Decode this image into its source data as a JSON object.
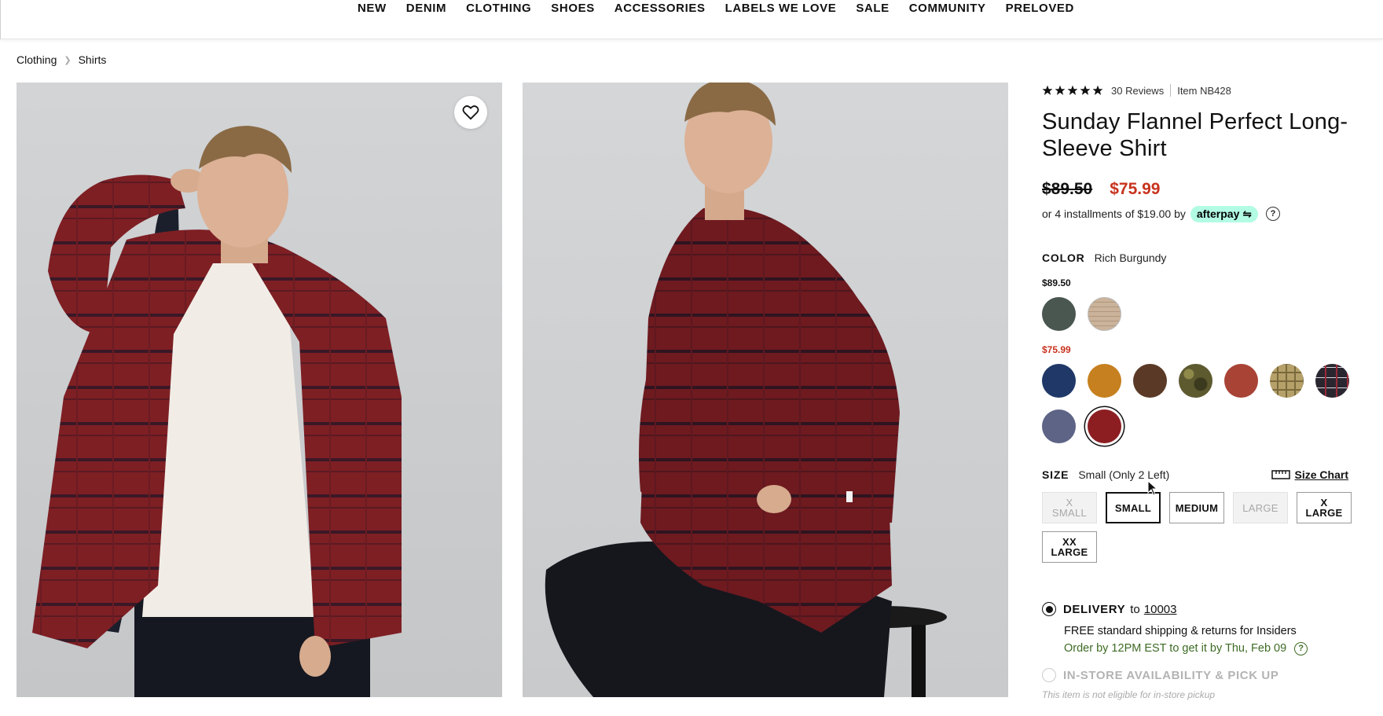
{
  "nav": {
    "items": [
      "NEW",
      "DENIM",
      "CLOTHING",
      "SHOES",
      "ACCESSORIES",
      "LABELS WE LOVE",
      "SALE",
      "COMMUNITY",
      "PRELOVED"
    ]
  },
  "breadcrumb": {
    "items": [
      "Clothing",
      "Shirts"
    ]
  },
  "product": {
    "reviews": "30 Reviews",
    "item": "Item NB428",
    "title": "Sunday Flannel Perfect Long-Sleeve Shirt",
    "price_original": "$89.50",
    "price_sale": "$75.99",
    "installments": "or 4 installments of $19.00 by",
    "afterpay": "afterpay",
    "color_label": "COLOR",
    "color_value": "Rich Burgundy",
    "tier_full_price": "$89.50",
    "tier_sale_price": "$75.99",
    "size_label": "SIZE",
    "size_value": "Small (Only 2 Left)",
    "size_chart": "Size Chart",
    "delivery_label": "DELIVERY",
    "delivery_to": "to",
    "delivery_zip": "10003",
    "shipping_bold": "FREE standard shipping & returns",
    "shipping_rest": " for Insiders",
    "order_by": "Order by 12PM EST to get it by Thu, Feb 09",
    "instore_label": "IN-STORE AVAILABILITY & PICK UP",
    "instore_note": "This item is not eligible for in-store pickup"
  },
  "swatches_full": [
    {
      "name": "dark-green",
      "color": "#4a5650"
    },
    {
      "name": "cream-plaid",
      "color": "#e0d2c3"
    }
  ],
  "swatches_sale": [
    {
      "name": "navy",
      "color": "#1f3868"
    },
    {
      "name": "mustard",
      "color": "#c6801f"
    },
    {
      "name": "brown",
      "color": "#5a3a26"
    },
    {
      "name": "camo",
      "color": "#5e5a30"
    },
    {
      "name": "rust",
      "color": "#a84336"
    },
    {
      "name": "tan-plaid",
      "color": "#b6a06a"
    },
    {
      "name": "black-plaid",
      "color": "#2a2630"
    },
    {
      "name": "slate-blue",
      "color": "#5d6486"
    },
    {
      "name": "rich-burgundy",
      "color": "#8c1e22",
      "selected": true
    }
  ],
  "sizes": [
    {
      "label": "X SMALL",
      "state": "disabled"
    },
    {
      "label": "SMALL",
      "state": "selected"
    },
    {
      "label": "MEDIUM",
      "state": "available"
    },
    {
      "label": "LARGE",
      "state": "disabled"
    },
    {
      "label": "X LARGE",
      "state": "available"
    },
    {
      "label": "XX LARGE",
      "state": "available"
    }
  ],
  "colors": {
    "sale_red": "#c8321e",
    "afterpay_mint": "#b2fce4",
    "green_text": "#3d6b24"
  },
  "icons": {
    "wishlist": "heart-icon",
    "rating": "star-icon",
    "ruler": "ruler-icon",
    "help": "question-icon"
  }
}
